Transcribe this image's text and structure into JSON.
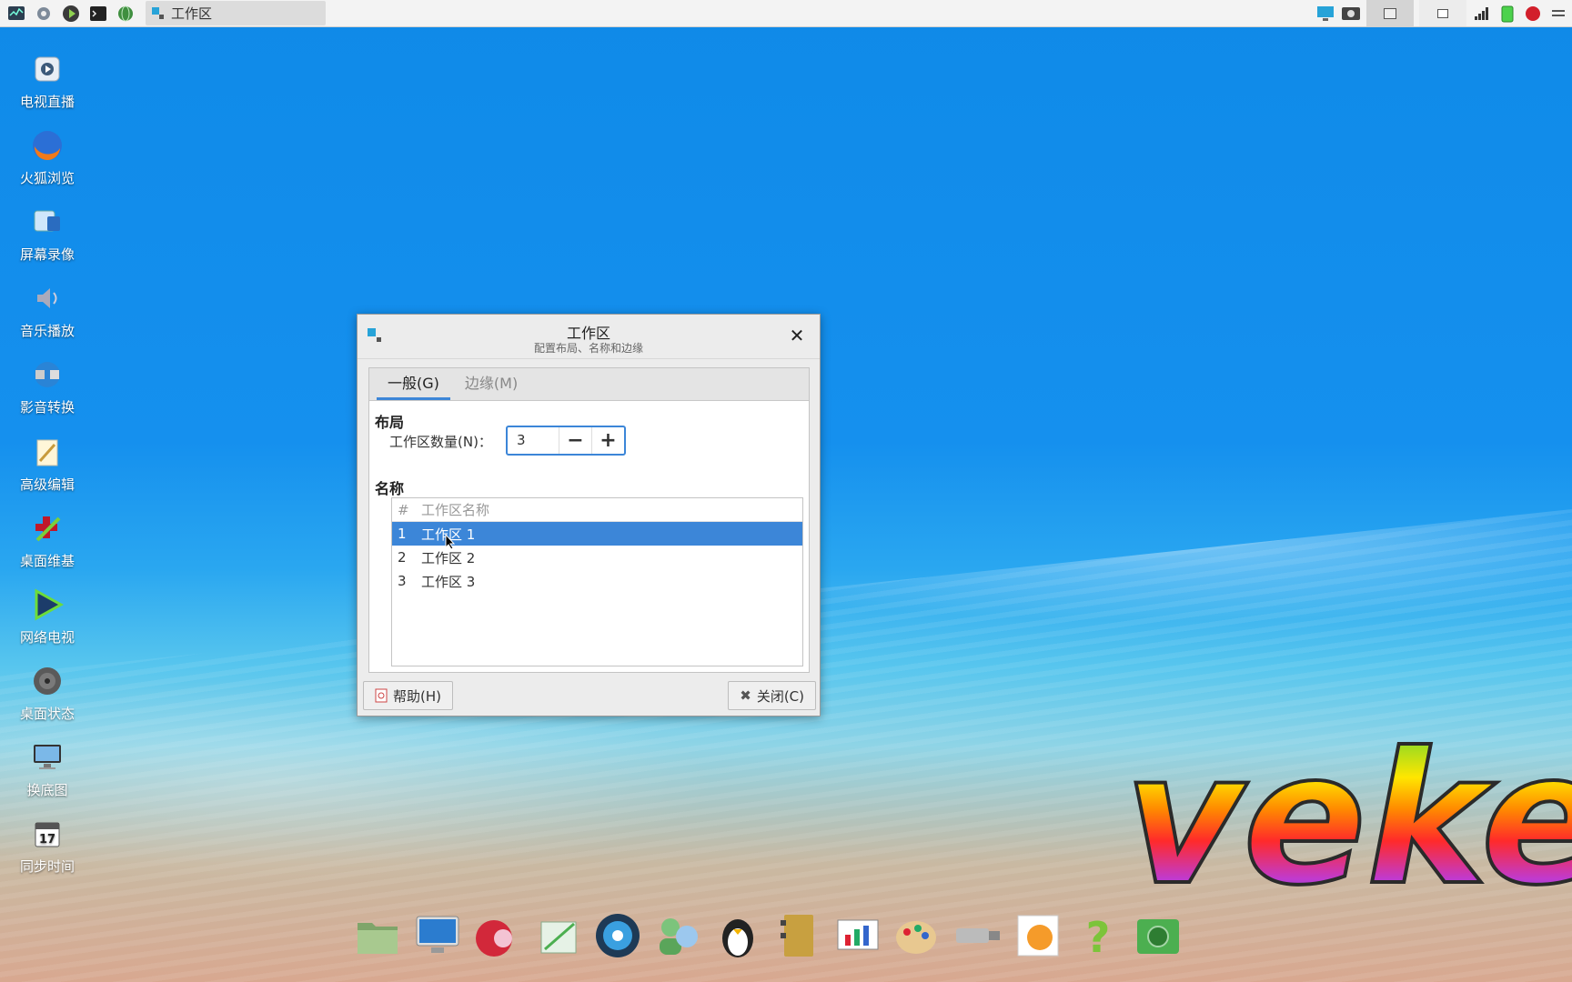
{
  "panel": {
    "launchers": [
      "system-monitor-icon",
      "settings-icon",
      "play-icon",
      "terminal-icon",
      "globe-icon"
    ],
    "task_title": "工作区"
  },
  "desktop_icons": [
    {
      "label": "电视直播",
      "icon": "tv-icon"
    },
    {
      "label": "火狐浏览",
      "icon": "firefox-icon"
    },
    {
      "label": "屏幕录像",
      "icon": "screen-record-icon"
    },
    {
      "label": "音乐播放",
      "icon": "speaker-icon"
    },
    {
      "label": "影音转换",
      "icon": "media-convert-icon"
    },
    {
      "label": "高级编辑",
      "icon": "editor-icon"
    },
    {
      "label": "桌面维基",
      "icon": "wiki-icon"
    },
    {
      "label": "网络电视",
      "icon": "play-triangle-icon"
    },
    {
      "label": "桌面状态",
      "icon": "status-icon"
    },
    {
      "label": "换底图",
      "icon": "wallpaper-icon"
    },
    {
      "label": "同步时间",
      "icon": "calendar-icon"
    }
  ],
  "dialog": {
    "title": "工作区",
    "subtitle": "配置布局、名称和边缘",
    "tabs": [
      {
        "label": "一般(G)",
        "active": true
      },
      {
        "label": "边缘(M)",
        "active": false
      }
    ],
    "layout_section": "布局",
    "workspace_count_label": "工作区数量(N)：",
    "workspace_count": "3",
    "names_section": "名称",
    "table": {
      "headers": [
        "#",
        "工作区名称"
      ],
      "rows": [
        {
          "num": "1",
          "name": "工作区 1",
          "selected": true
        },
        {
          "num": "2",
          "name": "工作区 2",
          "selected": false
        },
        {
          "num": "3",
          "name": "工作区 3",
          "selected": false
        }
      ]
    },
    "help_button": "帮助(H)",
    "close_button": "关闭(C)"
  },
  "logo_text": "veke",
  "dock_icons": [
    "files-icon",
    "monitor-icon",
    "mascot-icon",
    "notepad-icon",
    "media-player-icon",
    "users-icon",
    "tux-icon",
    "address-book-icon",
    "presentation-icon",
    "paint-icon",
    "usb-icon",
    "photo-icon",
    "help-icon",
    "camera-icon"
  ],
  "colors": {
    "accent": "#3c86d8",
    "desktop": "#1590ee"
  }
}
